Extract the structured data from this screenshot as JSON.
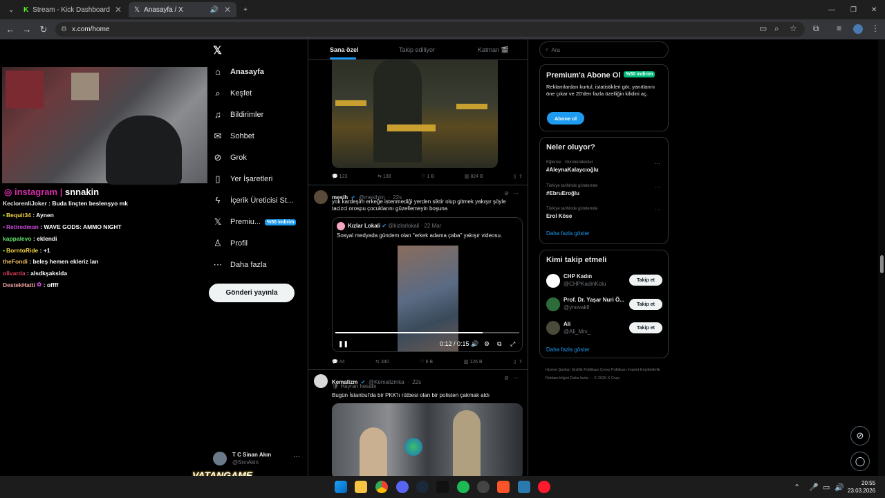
{
  "browser": {
    "tabs": [
      {
        "title": "Stream - Kick Dashboard"
      },
      {
        "title": "Anasayfa / X"
      }
    ],
    "url": "x.com/home"
  },
  "stream": {
    "instagram_label": "instagram",
    "instagram_handle": "snnakin",
    "chat": [
      {
        "user": "KeclorenliJoker",
        "msg": ": Buda linçten beslenşyo mk",
        "color": "#e7e9ea"
      },
      {
        "user": "Bequit34",
        "msg": ": Aynen",
        "color": "#f5d547"
      },
      {
        "user": "Retiredman",
        "msg": ": WAVE GODS: AMMO NIGHT",
        "color": "#c84ad8"
      },
      {
        "user": "kappalevo",
        "msg": ": eklendi",
        "color": "#63e26b"
      },
      {
        "user": "BorntoRide",
        "msg": ": +1",
        "color": "#f5d547"
      },
      {
        "user": "theFondi",
        "msg": ": beleş hemen ekleriz lan",
        "color": "#f0c060"
      },
      {
        "user": "olivarda",
        "msg": ": alsdkşakslda",
        "color": "#e0405a"
      },
      {
        "user": "DestekHatti",
        "msg": ": offff",
        "color": "#f0a0a0"
      }
    ],
    "watermark": "VATANGAME"
  },
  "nav": {
    "items": [
      {
        "label": "Anasayfa",
        "icon": "home-icon",
        "glyph": "⌂"
      },
      {
        "label": "Keşfet",
        "icon": "search-icon",
        "glyph": "⌕"
      },
      {
        "label": "Bildirimler",
        "icon": "bell-icon",
        "glyph": "♫"
      },
      {
        "label": "Sohbet",
        "icon": "mail-icon",
        "glyph": "✉"
      },
      {
        "label": "Grok",
        "icon": "grok-icon",
        "glyph": "⊘"
      },
      {
        "label": "Yer İşaretleri",
        "icon": "bookmark-icon",
        "glyph": "▮"
      },
      {
        "label": "İçerik Üreticisi St...",
        "icon": "lightning-icon",
        "glyph": "ϟ"
      },
      {
        "label": "Premiu...",
        "icon": "x-logo-icon",
        "glyph": "𝕏"
      },
      {
        "label": "Profil",
        "icon": "person-icon",
        "glyph": "♙"
      },
      {
        "label": "Daha fazla",
        "icon": "more-icon",
        "glyph": "⋯"
      }
    ],
    "premium_badge": "%50 indirim",
    "post_button": "Gönderi yayınla",
    "account_name": "T C Sinan Akın",
    "account_handle": "@SnnAkin"
  },
  "feed": {
    "tabs": [
      "Sana özel",
      "Takip ediliyor",
      "Katman 🎬"
    ],
    "tweet1_stats": {
      "reply": "123",
      "retweet": "138",
      "like": "1 B",
      "views": "824 B"
    },
    "tweet2": {
      "name": "mesih",
      "handle": "@mesihim",
      "time": "22s",
      "text": "yok kardeşim erkeğe istenmediği yerden siktir olup gitmek yakışır şöyle tacizci orospu çocuklarını güzellemeyin boşuna",
      "quote": {
        "name": "Kızlar Lokali",
        "handle": "@kizlarlokali",
        "date": "22 Mar",
        "text": "Sosyal medyada gündem olan \"erkek adama çaba\" yakışır videosu.",
        "time": "0:12 / 0:15",
        "progress": 0.8
      },
      "stats": {
        "reply": "44",
        "retweet": "340",
        "like": "6 B",
        "views": "126 B"
      }
    },
    "tweet3": {
      "name": "Kemalizm",
      "handle": "@Kemalizmka",
      "time": "22s",
      "label": "Hayran hesabı",
      "text": "Bugün İstanbul'da bir PKK'lı rütbesi olan bir polisten çakmak aldı"
    }
  },
  "sidebar": {
    "search_placeholder": "Ara",
    "premium": {
      "title": "Premium'a Abone Ol",
      "badge": "%50 indirim",
      "text": "Reklamlardan kurtul, istatistikleri gör, yanıtlarını öne çıkar ve 20'den fazla özelliğin kilidini aç.",
      "button": "Abone ol"
    },
    "trends": {
      "title": "Neler oluyor?",
      "items": [
        {
          "context": "Eğlence · Gündemdekiler",
          "tag": "#AleynaKalaycıoğlu"
        },
        {
          "context": "Türkiye tarihinde gündemde",
          "tag": "#EbruEroğlu"
        },
        {
          "context": "Türkiye tarihinde gündemde",
          "tag": "Erol Köse"
        }
      ],
      "more": "Daha fazla göster"
    },
    "follow": {
      "title": "Kimi takip etmeli",
      "items": [
        {
          "name": "CHP Kadın",
          "handle": "@CHPKadinKolu",
          "button": "Takip et"
        },
        {
          "name": "Prof. Dr. Yaşar Nuri Ö...",
          "handle": "@ynovakfi",
          "button": "Takip et"
        },
        {
          "name": "Ali",
          "handle": "@Ali_Mrv_",
          "button": "Takip et"
        }
      ],
      "more": "Daha fazla göster"
    },
    "footer": "Hizmet Şartları   Gizlilik Politikası   Çerez Politikası   Imprint   Erişilebilirlik   Reklam bilgisi   Daha fazla ···   © 2026 X Corp."
  },
  "taskbar": {
    "time": "20:55",
    "date": "23.03.2026"
  }
}
